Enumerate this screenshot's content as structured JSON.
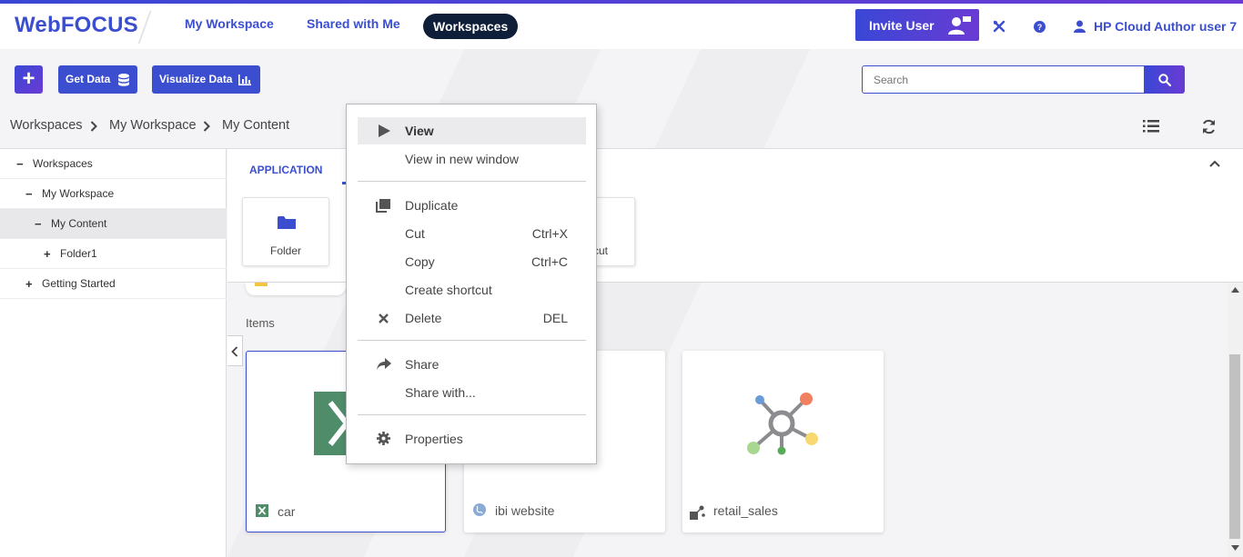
{
  "app": {
    "brand": "WebFOCUS"
  },
  "nav": {
    "my_workspace": "My Workspace",
    "shared": "Shared with Me",
    "workspaces": "Workspaces"
  },
  "header": {
    "invite": "Invite User",
    "user": "HP Cloud Author user 7"
  },
  "toolbar": {
    "get_data": "Get Data",
    "visualize": "Visualize Data"
  },
  "search": {
    "placeholder": "Search"
  },
  "breadcrumb": [
    "Workspaces",
    "My Workspace",
    "My Content"
  ],
  "tree": [
    {
      "sym": "−",
      "label": "Workspaces"
    },
    {
      "sym": "−",
      "label": "My Workspace"
    },
    {
      "sym": "−",
      "label": "My Content"
    },
    {
      "sym": "+",
      "label": "Folder1"
    },
    {
      "sym": "+",
      "label": "Getting Started"
    }
  ],
  "create": {
    "tab": "APPLICATION",
    "tiles": [
      "Folder",
      "cut"
    ]
  },
  "items": {
    "label": "Items",
    "cards": [
      "car",
      "ibi website",
      "retail_sales"
    ]
  },
  "context_menu": {
    "view": "View",
    "view_new": "View in new window",
    "duplicate": "Duplicate",
    "cut": "Cut",
    "cut_sc": "Ctrl+X",
    "copy": "Copy",
    "copy_sc": "Ctrl+C",
    "create_shortcut": "Create shortcut",
    "delete": "Delete",
    "delete_sc": "DEL",
    "share": "Share",
    "share_with": "Share with...",
    "properties": "Properties"
  },
  "colors": {
    "accent": "#3b4ed0",
    "accent2": "#6a3bd4",
    "dark_pill": "#0f1f3a",
    "excel": "#4e8c6a"
  }
}
